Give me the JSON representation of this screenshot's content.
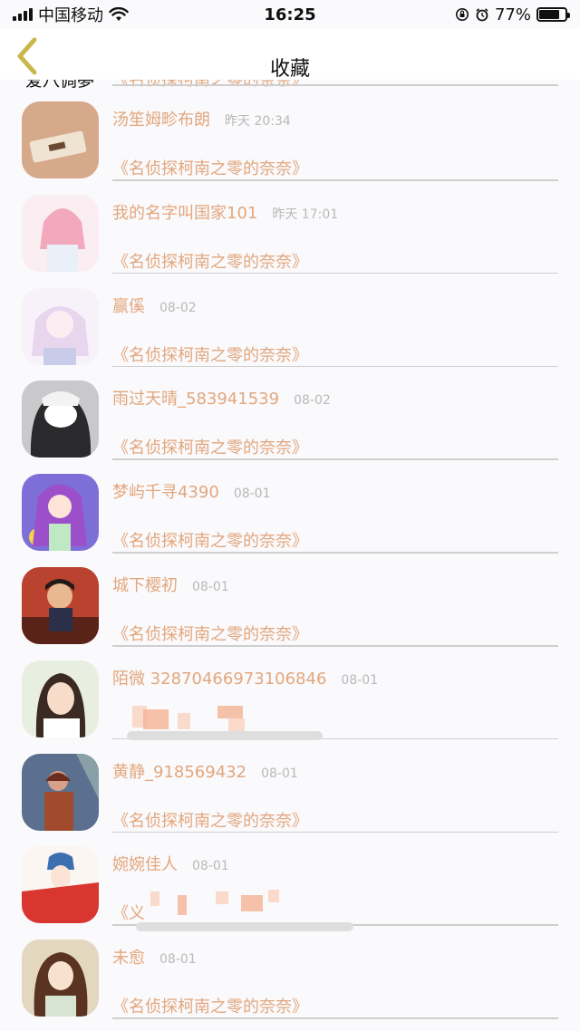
{
  "status_bar": {
    "carrier": "中国移动",
    "time": "16:25",
    "battery": "77%",
    "battery_level": 0.77
  },
  "nav": {
    "back_icon": "chevron-left-icon",
    "title": "收藏"
  },
  "colors": {
    "accent": "#e2a77e",
    "date": "#b9b9b9",
    "back_icon": "#c8b84a"
  },
  "partial_row": {
    "name": "爱八倜夢",
    "book_title": "《名侦探柯南之零的奈奈》"
  },
  "items": [
    {
      "name": "汤笙姆畛布朗",
      "date": "昨天 20:34",
      "book_title": "《名侦探柯南之零的奈奈》"
    },
    {
      "name": "我的名字叫国家101",
      "date": "昨天 17:01",
      "book_title": "《名侦探柯南之零的奈奈》"
    },
    {
      "name": "赢傒",
      "date": "08-02",
      "book_title": "《名侦探柯南之零的奈奈》"
    },
    {
      "name": "雨过天晴_583941539",
      "date": "08-02",
      "book_title": "《名侦探柯南之零的奈奈》"
    },
    {
      "name": "梦屿千寻4390",
      "date": "08-01",
      "book_title": "《名侦探柯南之零的奈奈》"
    },
    {
      "name": "城下樱初",
      "date": "08-01",
      "book_title": "《名侦探柯南之零的奈奈》"
    },
    {
      "name": "陌微 32870466973106846",
      "date": "08-01",
      "book_title": ""
    },
    {
      "name": "黄静_918569432",
      "date": "08-01",
      "book_title": "《名侦探柯南之零的奈奈》"
    },
    {
      "name": "婉婉佳人",
      "date": "08-01",
      "book_title": "《义"
    },
    {
      "name": "未愈",
      "date": "08-01",
      "book_title": "《名侦探柯南之零的奈奈》"
    }
  ]
}
